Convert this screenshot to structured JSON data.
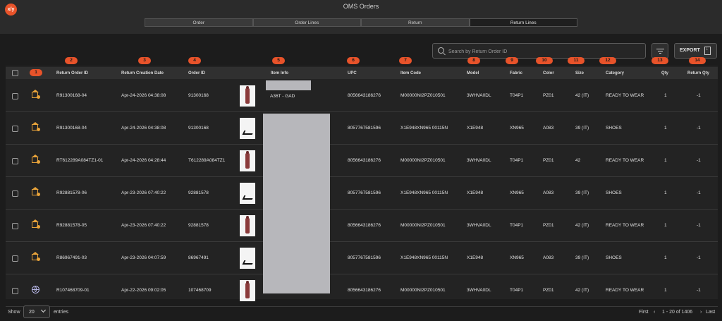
{
  "app": {
    "logo": "x/y",
    "title": "OMS Orders"
  },
  "tabs": [
    {
      "label": "Order",
      "active": false
    },
    {
      "label": "Order Lines",
      "active": false
    },
    {
      "label": "Return",
      "active": false
    },
    {
      "label": "Return Lines",
      "active": true
    }
  ],
  "toolbar": {
    "search_placeholder": "Search by Return Order ID",
    "export_label": "EXPORT",
    "filter_icon": "filter-icon",
    "export_icon": "export-file-icon"
  },
  "colors": {
    "accent": "#e8532a",
    "return_icon": "#e8a33a",
    "globe_icon": "#b6b6e6",
    "background": "#1c1c1c"
  },
  "columns": [
    {
      "label": "",
      "badge": "1"
    },
    {
      "label": "Return Order ID",
      "badge": "2"
    },
    {
      "label": "Return Creation Date",
      "badge": "3"
    },
    {
      "label": "Order ID",
      "badge": "4"
    },
    {
      "label": "Item Info",
      "badge": "5"
    },
    {
      "label": "UPC",
      "badge": "6"
    },
    {
      "label": "Item Code",
      "badge": "7"
    },
    {
      "label": "Model",
      "badge": "8"
    },
    {
      "label": "Fabric",
      "badge": "9"
    },
    {
      "label": "Color",
      "badge": "10"
    },
    {
      "label": "Size",
      "badge": "11"
    },
    {
      "label": "Category",
      "badge": "12"
    },
    {
      "label": "Qty",
      "badge": "13"
    },
    {
      "label": "Return Qty",
      "badge": "14"
    }
  ],
  "rows": [
    {
      "icon": "return-house-icon",
      "thumb": "garment",
      "return_order_id": "R91300168-04",
      "date": "Apr-24-2026 04:38:08",
      "order_id": "91300168",
      "item_info": "A36T - GAD",
      "upc": "8056643186276",
      "item_code": "M00000NI2PZ010501",
      "model": "3WHVA0DL",
      "fabric": "T04P1",
      "color": "PZ01",
      "size": "42 (IT)",
      "category": "READY TO WEAR",
      "qty": "1",
      "return_qty": "-1"
    },
    {
      "icon": "return-house-icon",
      "thumb": "shoe",
      "return_order_id": "R91300168-04",
      "date": "Apr-24-2026 04:38:08",
      "order_id": "91300168",
      "item_info": "",
      "upc": "8057767581596",
      "item_code": "X1E948XN965 00115N",
      "model": "X1E948",
      "fabric": "XN965",
      "color": "A083",
      "size": "39 (IT)",
      "category": "SHOES",
      "qty": "1",
      "return_qty": "-1"
    },
    {
      "icon": "return-house-icon",
      "thumb": "garment",
      "return_order_id": "RT612289A084TZ1-01",
      "date": "Apr-24-2026 04:28:44",
      "order_id": "T612289A084TZ1",
      "item_info": "",
      "upc": "8056643186276",
      "item_code": "M00000NI2PZ010501",
      "model": "3WHVA0DL",
      "fabric": "T04P1",
      "color": "PZ01",
      "size": "42",
      "category": "READY TO WEAR",
      "qty": "1",
      "return_qty": "-1"
    },
    {
      "icon": "return-house-icon",
      "thumb": "shoe",
      "return_order_id": "R92881578-06",
      "date": "Apr-23-2026 07:40:22",
      "order_id": "92881578",
      "item_info": "",
      "upc": "8057767581596",
      "item_code": "X1E948XN965 00115N",
      "model": "X1E948",
      "fabric": "XN965",
      "color": "A083",
      "size": "39 (IT)",
      "category": "SHOES",
      "qty": "1",
      "return_qty": "-1"
    },
    {
      "icon": "return-house-icon",
      "thumb": "garment",
      "return_order_id": "R92881578-05",
      "date": "Apr-23-2026 07:40:22",
      "order_id": "92881578",
      "item_info": "",
      "upc": "8056643186276",
      "item_code": "M00000NI2PZ010501",
      "model": "3WHVA0DL",
      "fabric": "T04P1",
      "color": "PZ01",
      "size": "42 (IT)",
      "category": "READY TO WEAR",
      "qty": "1",
      "return_qty": "-1"
    },
    {
      "icon": "return-house-icon",
      "thumb": "shoe",
      "return_order_id": "R86967491-03",
      "date": "Apr-23-2026 04:07:59",
      "order_id": "86967491",
      "item_info": "",
      "upc": "8057767581596",
      "item_code": "X1E948XN965 00115N",
      "model": "X1E948",
      "fabric": "XN965",
      "color": "A083",
      "size": "39 (IT)",
      "category": "SHOES",
      "qty": "1",
      "return_qty": "-1"
    },
    {
      "icon": "globe-icon",
      "thumb": "garment",
      "return_order_id": "R107468709-01",
      "date": "Apr-22-2026 09:02:05",
      "order_id": "107468709",
      "item_info": "",
      "upc": "8056643186276",
      "item_code": "M00000NI2PZ010501",
      "model": "3WHVA0DL",
      "fabric": "T04P1",
      "color": "PZ01",
      "size": "42 (IT)",
      "category": "READY TO WEAR",
      "qty": "1",
      "return_qty": "-1"
    }
  ],
  "footer": {
    "show_label": "Show",
    "entries_value": "20",
    "entries_label": "entries",
    "first_label": "First",
    "range_label": "1 - 20 of 1406",
    "last_label": "Last",
    "prev_icon": "‹",
    "next_icon": "›"
  }
}
